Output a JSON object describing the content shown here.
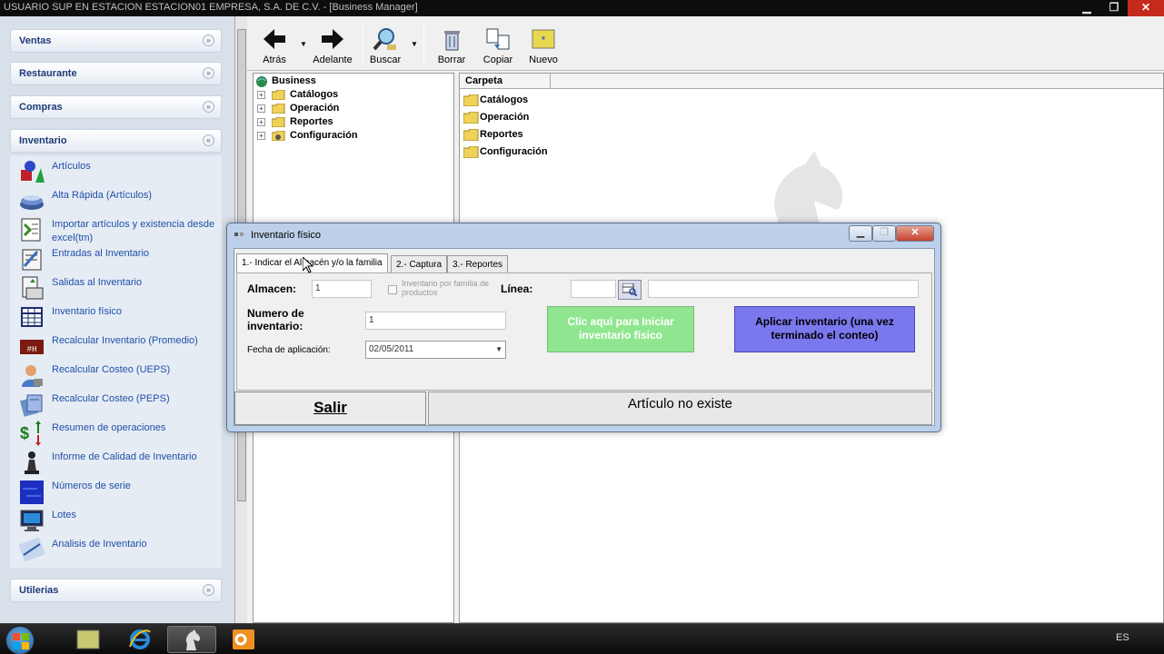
{
  "window": {
    "title": "USUARIO SUP EN ESTACION ESTACION01    EMPRESA, S.A. DE C.V. - [Business Manager]",
    "min_glyph": "▁",
    "max_glyph": "❐",
    "close_glyph": "✕"
  },
  "sidebar": {
    "groups": [
      {
        "label": "Ventas",
        "chevron": "»"
      },
      {
        "label": "Restaurante",
        "chevron": "»"
      },
      {
        "label": "Compras",
        "chevron": "»"
      },
      {
        "label": "Inventario",
        "chevron": "«"
      },
      {
        "label": "Utilerias",
        "chevron": "»"
      }
    ],
    "inventario_items": [
      {
        "label": "Artículos",
        "icon": "shapes-icon"
      },
      {
        "label": "Alta Rápida (Artículos)",
        "icon": "stack-icon"
      },
      {
        "label": "Importar artículos y existencia desde excel(tm)",
        "icon": "import-icon"
      },
      {
        "label": "Entradas al Inventario",
        "icon": "entry-icon"
      },
      {
        "label": "Salidas al Inventario",
        "icon": "exit-icon"
      },
      {
        "label": "Inventario físico",
        "icon": "grid-icon"
      },
      {
        "label": "Recalcular Inventario (Promedio)",
        "icon": "calc-icon"
      },
      {
        "label": "Recalcular Costeo (UEPS)",
        "icon": "person-icon"
      },
      {
        "label": "Recalcular Costeo (PEPS)",
        "icon": "cards-icon"
      },
      {
        "label": "Resumen de operaciones",
        "icon": "dollar-icon"
      },
      {
        "label": "Informe de Calidad de Inventario",
        "icon": "chess-icon"
      },
      {
        "label": "Números de serie",
        "icon": "serial-icon"
      },
      {
        "label": "Lotes",
        "icon": "monitor-icon"
      },
      {
        "label": "Analisis de Inventario",
        "icon": "chart-icon"
      }
    ]
  },
  "toolbar": {
    "buttons": [
      {
        "label": "Atrás",
        "icon": "back-arrow-icon"
      },
      {
        "label": "Adelante",
        "icon": "forward-arrow-icon"
      },
      {
        "label": "Buscar",
        "icon": "search-icon"
      },
      {
        "label": "Borrar",
        "icon": "delete-icon"
      },
      {
        "label": "Copiar",
        "icon": "copy-icon"
      },
      {
        "label": "Nuevo",
        "icon": "new-icon"
      }
    ]
  },
  "tree": {
    "root": "Business",
    "children": [
      "Catálogos",
      "Operación",
      "Reportes",
      "Configuración"
    ]
  },
  "list": {
    "column_header": "Carpeta",
    "rows": [
      "Catálogos",
      "Operación",
      "Reportes",
      "Configuración"
    ]
  },
  "dialog": {
    "title": "Inventario físico",
    "tabs": [
      "1.- Indicar el Almacén y/o la familia",
      "2.- Captura",
      "3.- Reportes"
    ],
    "almacen_label": "Almacen:",
    "almacen_value": "1",
    "checkbox_label": "Inventario por familia de productos",
    "linea_label": "Línea:",
    "linea_value": "",
    "linea_desc": "",
    "numero_label": "Numero de inventario:",
    "numero_value": "1",
    "fecha_label": "Fecha de aplicación:",
    "fecha_value": "02/05/2011",
    "iniciar_button": "Clic aqui para Iniciar inventario físico",
    "aplicar_button": "Aplicar inventario  (una vez terminado el conteo)",
    "salir_button": "Salir",
    "status_text": "Artículo no existe",
    "colors": {
      "iniciar": "#90e690",
      "aplicar": "#7b78ee"
    }
  },
  "taskbar": {
    "language": "ES"
  }
}
